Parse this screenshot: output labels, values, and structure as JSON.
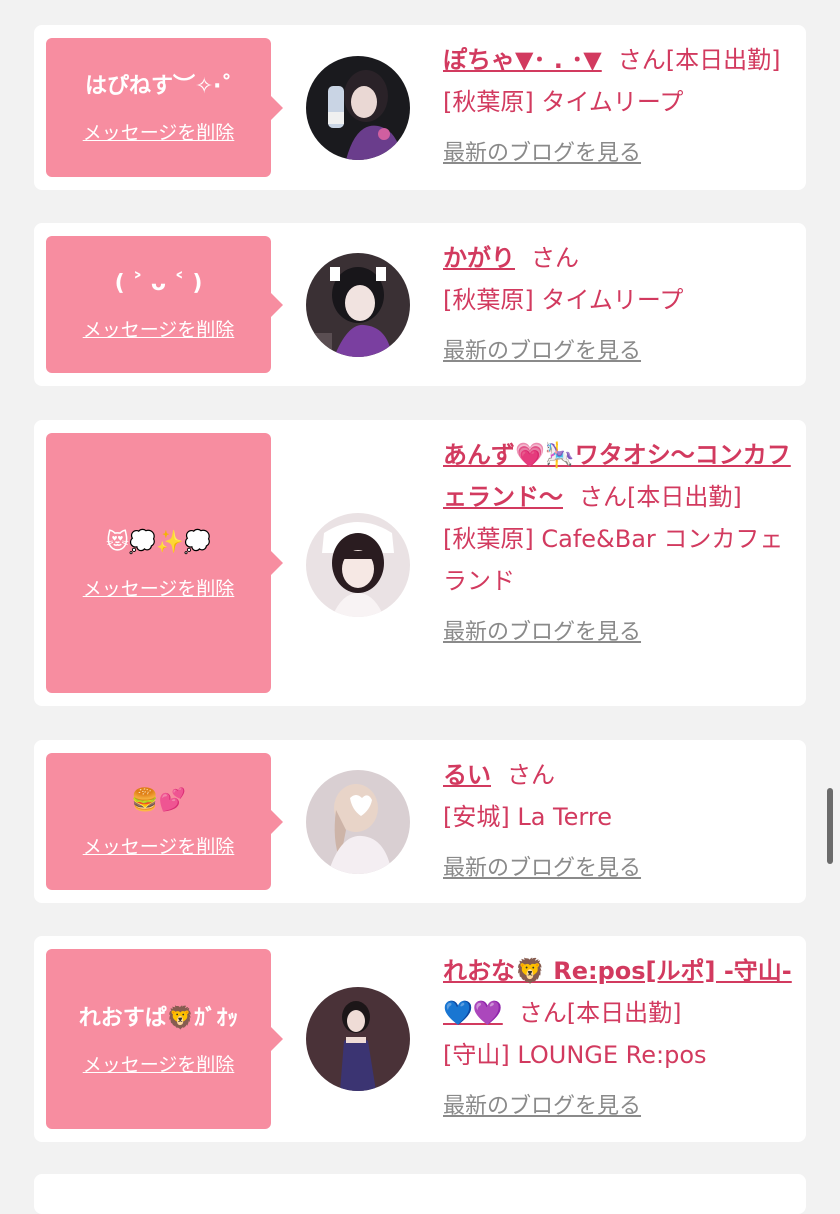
{
  "common": {
    "delete_label": "メッセージを削除",
    "view_blog_label": "最新のブログを見る",
    "honorific": "さん"
  },
  "messages": [
    {
      "bubble_text": "はぴねす︶✧‧˚",
      "name": "ぽちゃ▼･ . ･▼",
      "attend": "[本日出勤]",
      "shop": "[秋葉原] タイムリープ"
    },
    {
      "bubble_text": "( ˃ ᴗ ˂ )",
      "name": "かがり",
      "attend": "",
      "shop": "[秋葉原] タイムリープ"
    },
    {
      "bubble_text": "😻💭✨💭",
      "name": "あんず💗🎠ワタオシ〜コンカフェランド〜",
      "attend": "[本日出勤]",
      "shop": "[秋葉原] Cafe&Bar コンカフェランド"
    },
    {
      "bubble_text": "🍔💕",
      "name": "るい",
      "attend": "",
      "shop": "[安城] La Terre"
    },
    {
      "bubble_text": "れおすぱ🦁ｶﾞｵｯ",
      "name": "れおな🦁 Re:pos[ルポ] -守山-💙💜",
      "attend": "[本日出勤]",
      "shop": "[守山] LOUNGE Re:pos"
    }
  ],
  "colors": {
    "bubble": "#f78da0",
    "accent_text": "#d23a5f",
    "link_gray": "#8a8a8a",
    "background": "#f2f2f2"
  }
}
